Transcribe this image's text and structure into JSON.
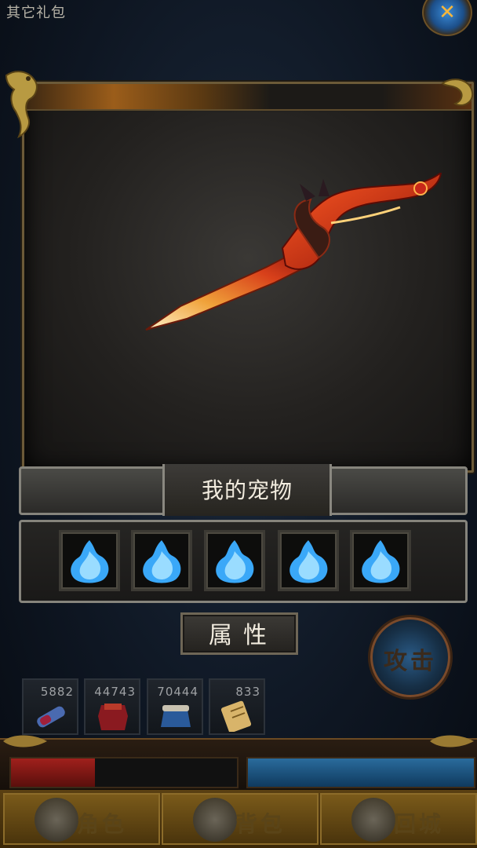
{
  "header": {
    "top_label": "其它礼包"
  },
  "showcase": {
    "header_text": ""
  },
  "pets": {
    "title": "我的宠物",
    "slots": [
      {
        "icon": "blue-flame-icon"
      },
      {
        "icon": "blue-flame-icon"
      },
      {
        "icon": "blue-flame-icon"
      },
      {
        "icon": "blue-flame-icon"
      },
      {
        "icon": "blue-flame-icon"
      }
    ]
  },
  "attribute_button": {
    "label": "属性"
  },
  "attack_button": {
    "label": "攻击"
  },
  "items": [
    {
      "count": "5882",
      "icon": "blue-potion-icon"
    },
    {
      "count": "44743",
      "icon": "red-armor-icon"
    },
    {
      "count": "70444",
      "icon": "blue-pot-icon"
    },
    {
      "count": "833",
      "icon": "scroll-icon"
    }
  ],
  "status": {
    "hp_fraction": 0.37,
    "mp_fraction": 1.0
  },
  "bottom_nav": [
    {
      "label": "角色"
    },
    {
      "label": "背包"
    },
    {
      "label": "回城"
    }
  ],
  "colors": {
    "hp": "#a0201c",
    "mp": "#2a6b9c",
    "frame_gold": "#6c5a38"
  }
}
